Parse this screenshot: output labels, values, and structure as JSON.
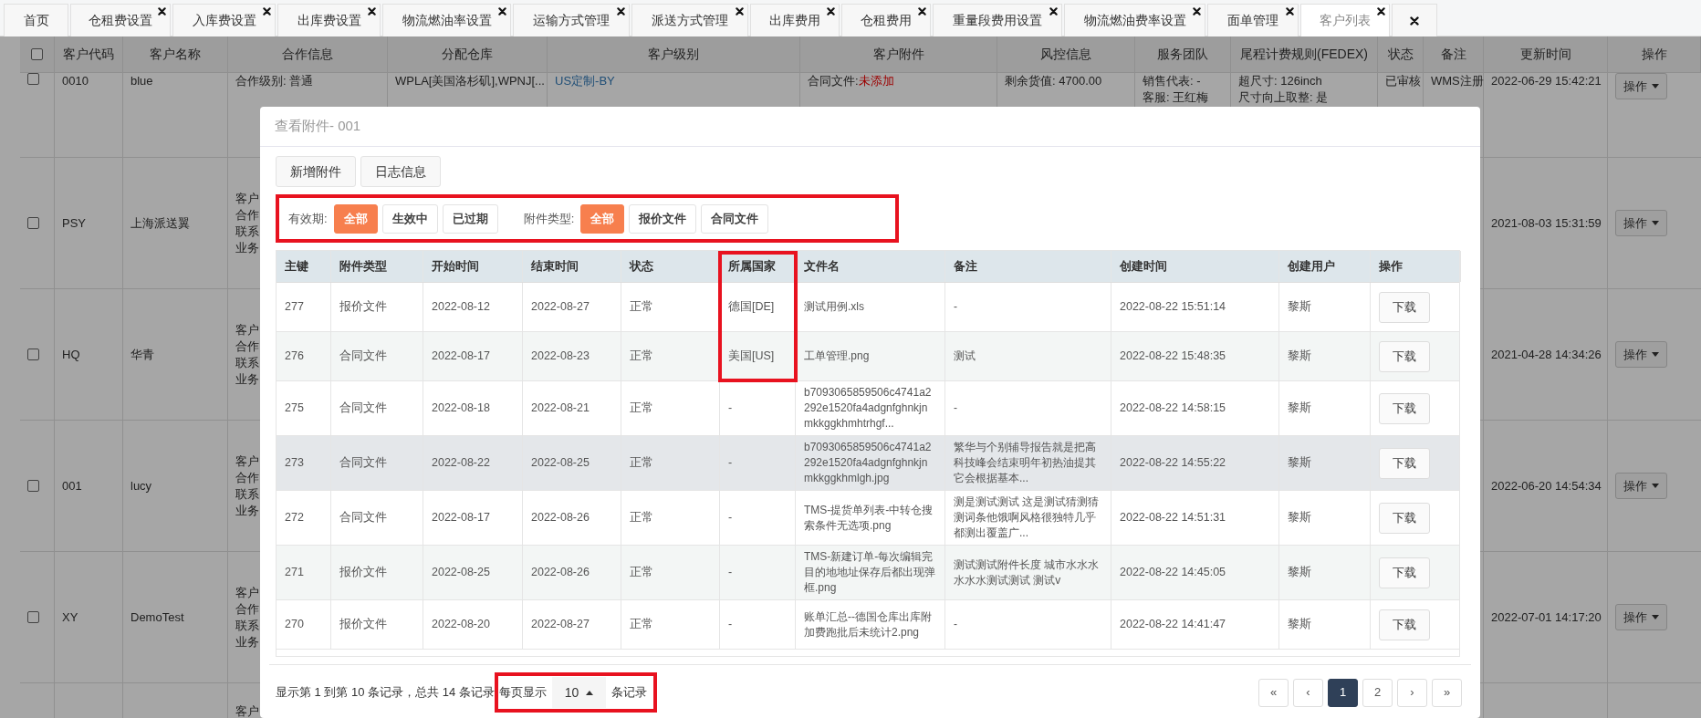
{
  "tabs": [
    {
      "label": "首页",
      "closable": false,
      "selected": false
    },
    {
      "label": "仓租费设置",
      "closable": true,
      "selected": false
    },
    {
      "label": "入库费设置",
      "closable": true,
      "selected": false
    },
    {
      "label": "出库费设置",
      "closable": true,
      "selected": false
    },
    {
      "label": "物流燃油率设置",
      "closable": true,
      "selected": false
    },
    {
      "label": "运输方式管理",
      "closable": true,
      "selected": false
    },
    {
      "label": "派送方式管理",
      "closable": true,
      "selected": false
    },
    {
      "label": "出库费用",
      "closable": true,
      "selected": false
    },
    {
      "label": "仓租费用",
      "closable": true,
      "selected": false
    },
    {
      "label": "重量段费用设置",
      "closable": true,
      "selected": false
    },
    {
      "label": "物流燃油费率设置",
      "closable": true,
      "selected": false
    },
    {
      "label": "面单管理",
      "closable": true,
      "selected": false
    },
    {
      "label": "客户列表",
      "closable": true,
      "selected": true
    }
  ],
  "customer_table": {
    "columns": [
      "客户代码",
      "客户名称",
      "合作信息",
      "分配仓库",
      "客户级别",
      "客户附件",
      "风控信息",
      "服务团队",
      "尾程计费规则(FEDEX)",
      "状态",
      "备注",
      "更新时间",
      "操作"
    ],
    "rows": [
      {
        "checked": false,
        "code": "0010",
        "name": "blue",
        "coop_info": [
          "合作级别: 普通"
        ],
        "warehouse": "WPLA[美国洛杉矶],WPNJ[...",
        "level": "US定制-BY",
        "attachment": {
          "label": "合同文件:",
          "value": "未添加"
        },
        "risk": [
          "剩余货值: 4700.00"
        ],
        "team": [
          "销售代表: -",
          "客服: 王红梅"
        ],
        "fedex": [
          "超尺寸: 126inch",
          "尺寸向上取整: 是"
        ],
        "status": "已审核",
        "note": "WMS注册",
        "updated": "2022-06-29 15:42:21",
        "action": "操作"
      },
      {
        "checked": false,
        "code": "PSY",
        "name": "上海派送翼",
        "coop_info": [
          "客户",
          "合作",
          "联系",
          "业务"
        ],
        "updated": "2021-08-03 15:31:59",
        "action": "操作"
      },
      {
        "checked": false,
        "code": "HQ",
        "name": "华青",
        "coop_info": [
          "客户",
          "合作",
          "联系",
          "业务"
        ],
        "updated": "2021-04-28 14:34:26",
        "action": "操作"
      },
      {
        "checked": false,
        "code": "001",
        "name": "lucy",
        "coop_info": [
          "客户",
          "合作",
          "联系",
          "业务"
        ],
        "updated": "2022-06-20 14:54:34",
        "action": "操作"
      },
      {
        "checked": false,
        "code": "XY",
        "name": "DemoTest",
        "coop_info": [
          "客户",
          "合作",
          "联系",
          "业务"
        ],
        "updated": "2022-07-01 14:17:20",
        "action": "操作"
      },
      {
        "coop_info": [
          "客户"
        ]
      }
    ],
    "select_all_checked": false
  },
  "modal": {
    "title": "查看附件- 001",
    "buttons": [
      "新增附件",
      "日志信息"
    ],
    "filters": [
      {
        "label": "有效期:",
        "options": [
          {
            "label": "全部",
            "selected": true
          },
          {
            "label": "生效中",
            "selected": false
          },
          {
            "label": "已过期",
            "selected": false
          }
        ]
      },
      {
        "label": "附件类型:",
        "options": [
          {
            "label": "全部",
            "selected": true
          },
          {
            "label": "报价文件",
            "selected": false
          },
          {
            "label": "合同文件",
            "selected": false
          }
        ]
      }
    ],
    "table": {
      "columns": [
        "主键",
        "附件类型",
        "开始时间",
        "结束时间",
        "状态",
        "所属国家",
        "文件名",
        "备注",
        "创建时间",
        "创建用户",
        "操作"
      ],
      "rows": [
        {
          "id": "277",
          "type": "报价文件",
          "start": "2022-08-12",
          "end": "2022-08-27",
          "status": "正常",
          "country": "德国[DE]",
          "file": "测试用例.xls",
          "remark": "-",
          "created": "2022-08-22 15:51:14",
          "user": "黎斯",
          "action": "下载",
          "highlighted": false
        },
        {
          "id": "276",
          "type": "合同文件",
          "start": "2022-08-17",
          "end": "2022-08-23",
          "status": "正常",
          "country": "美国[US]",
          "file": "工单管理.png",
          "remark": "测试",
          "created": "2022-08-22 15:48:35",
          "user": "黎斯",
          "action": "下载",
          "highlighted": false
        },
        {
          "id": "275",
          "type": "合同文件",
          "start": "2022-08-18",
          "end": "2022-08-21",
          "status": "正常",
          "country": "-",
          "file": "b7093065859506c4741a2292e1520fa4adgnfghnkjnmkkggkhmhtrhgf...",
          "remark": "-",
          "created": "2022-08-22 14:58:15",
          "user": "黎斯",
          "action": "下载",
          "highlighted": false
        },
        {
          "id": "273",
          "type": "合同文件",
          "start": "2022-08-22",
          "end": "2022-08-25",
          "status": "正常",
          "country": "-",
          "file": "b7093065859506c4741a2292e1520fa4adgnfghnkjnmkkggkhmlgh.jpg",
          "remark": "繁华与个别辅导报告就是把高科技峰会结束明年初热油提其它会根据基本...",
          "created": "2022-08-22 14:55:22",
          "user": "黎斯",
          "action": "下载",
          "highlighted": true
        },
        {
          "id": "272",
          "type": "合同文件",
          "start": "2022-08-17",
          "end": "2022-08-26",
          "status": "正常",
          "country": "-",
          "file": "TMS-提货单列表-中转仓搜索条件无选项.png",
          "remark": "测是测试测试 这是测试猜测猜测词条他饿啊风格很独特几乎都测出覆盖广...",
          "created": "2022-08-22 14:51:31",
          "user": "黎斯",
          "action": "下载",
          "highlighted": false
        },
        {
          "id": "271",
          "type": "报价文件",
          "start": "2022-08-25",
          "end": "2022-08-26",
          "status": "正常",
          "country": "-",
          "file": "TMS-新建订单-每次编辑完目的地地址保存后都出现弹框.png",
          "remark": "测试测试附件长度 城市水水水水水水测试测试 测试v",
          "created": "2022-08-22 14:45:05",
          "user": "黎斯",
          "action": "下载",
          "highlighted": false
        },
        {
          "id": "270",
          "type": "报价文件",
          "start": "2022-08-20",
          "end": "2022-08-27",
          "status": "正常",
          "country": "-",
          "file": "账单汇总--德国仓库出库附加费跑批后未统计2.png",
          "remark": "-",
          "created": "2022-08-22 14:41:47",
          "user": "黎斯",
          "action": "下载",
          "highlighted": false
        }
      ]
    },
    "summary": "显示第 1 到第 10 条记录，总共 14 条记录",
    "page_size_label": "每页显示",
    "page_size": "10",
    "page_size_suffix": "条记录",
    "pages": [
      {
        "label": "«",
        "selected": false
      },
      {
        "label": "‹",
        "selected": false
      },
      {
        "label": "1",
        "selected": true
      },
      {
        "label": "2",
        "selected": false
      },
      {
        "label": "›",
        "selected": false
      },
      {
        "label": "»",
        "selected": false
      }
    ]
  }
}
